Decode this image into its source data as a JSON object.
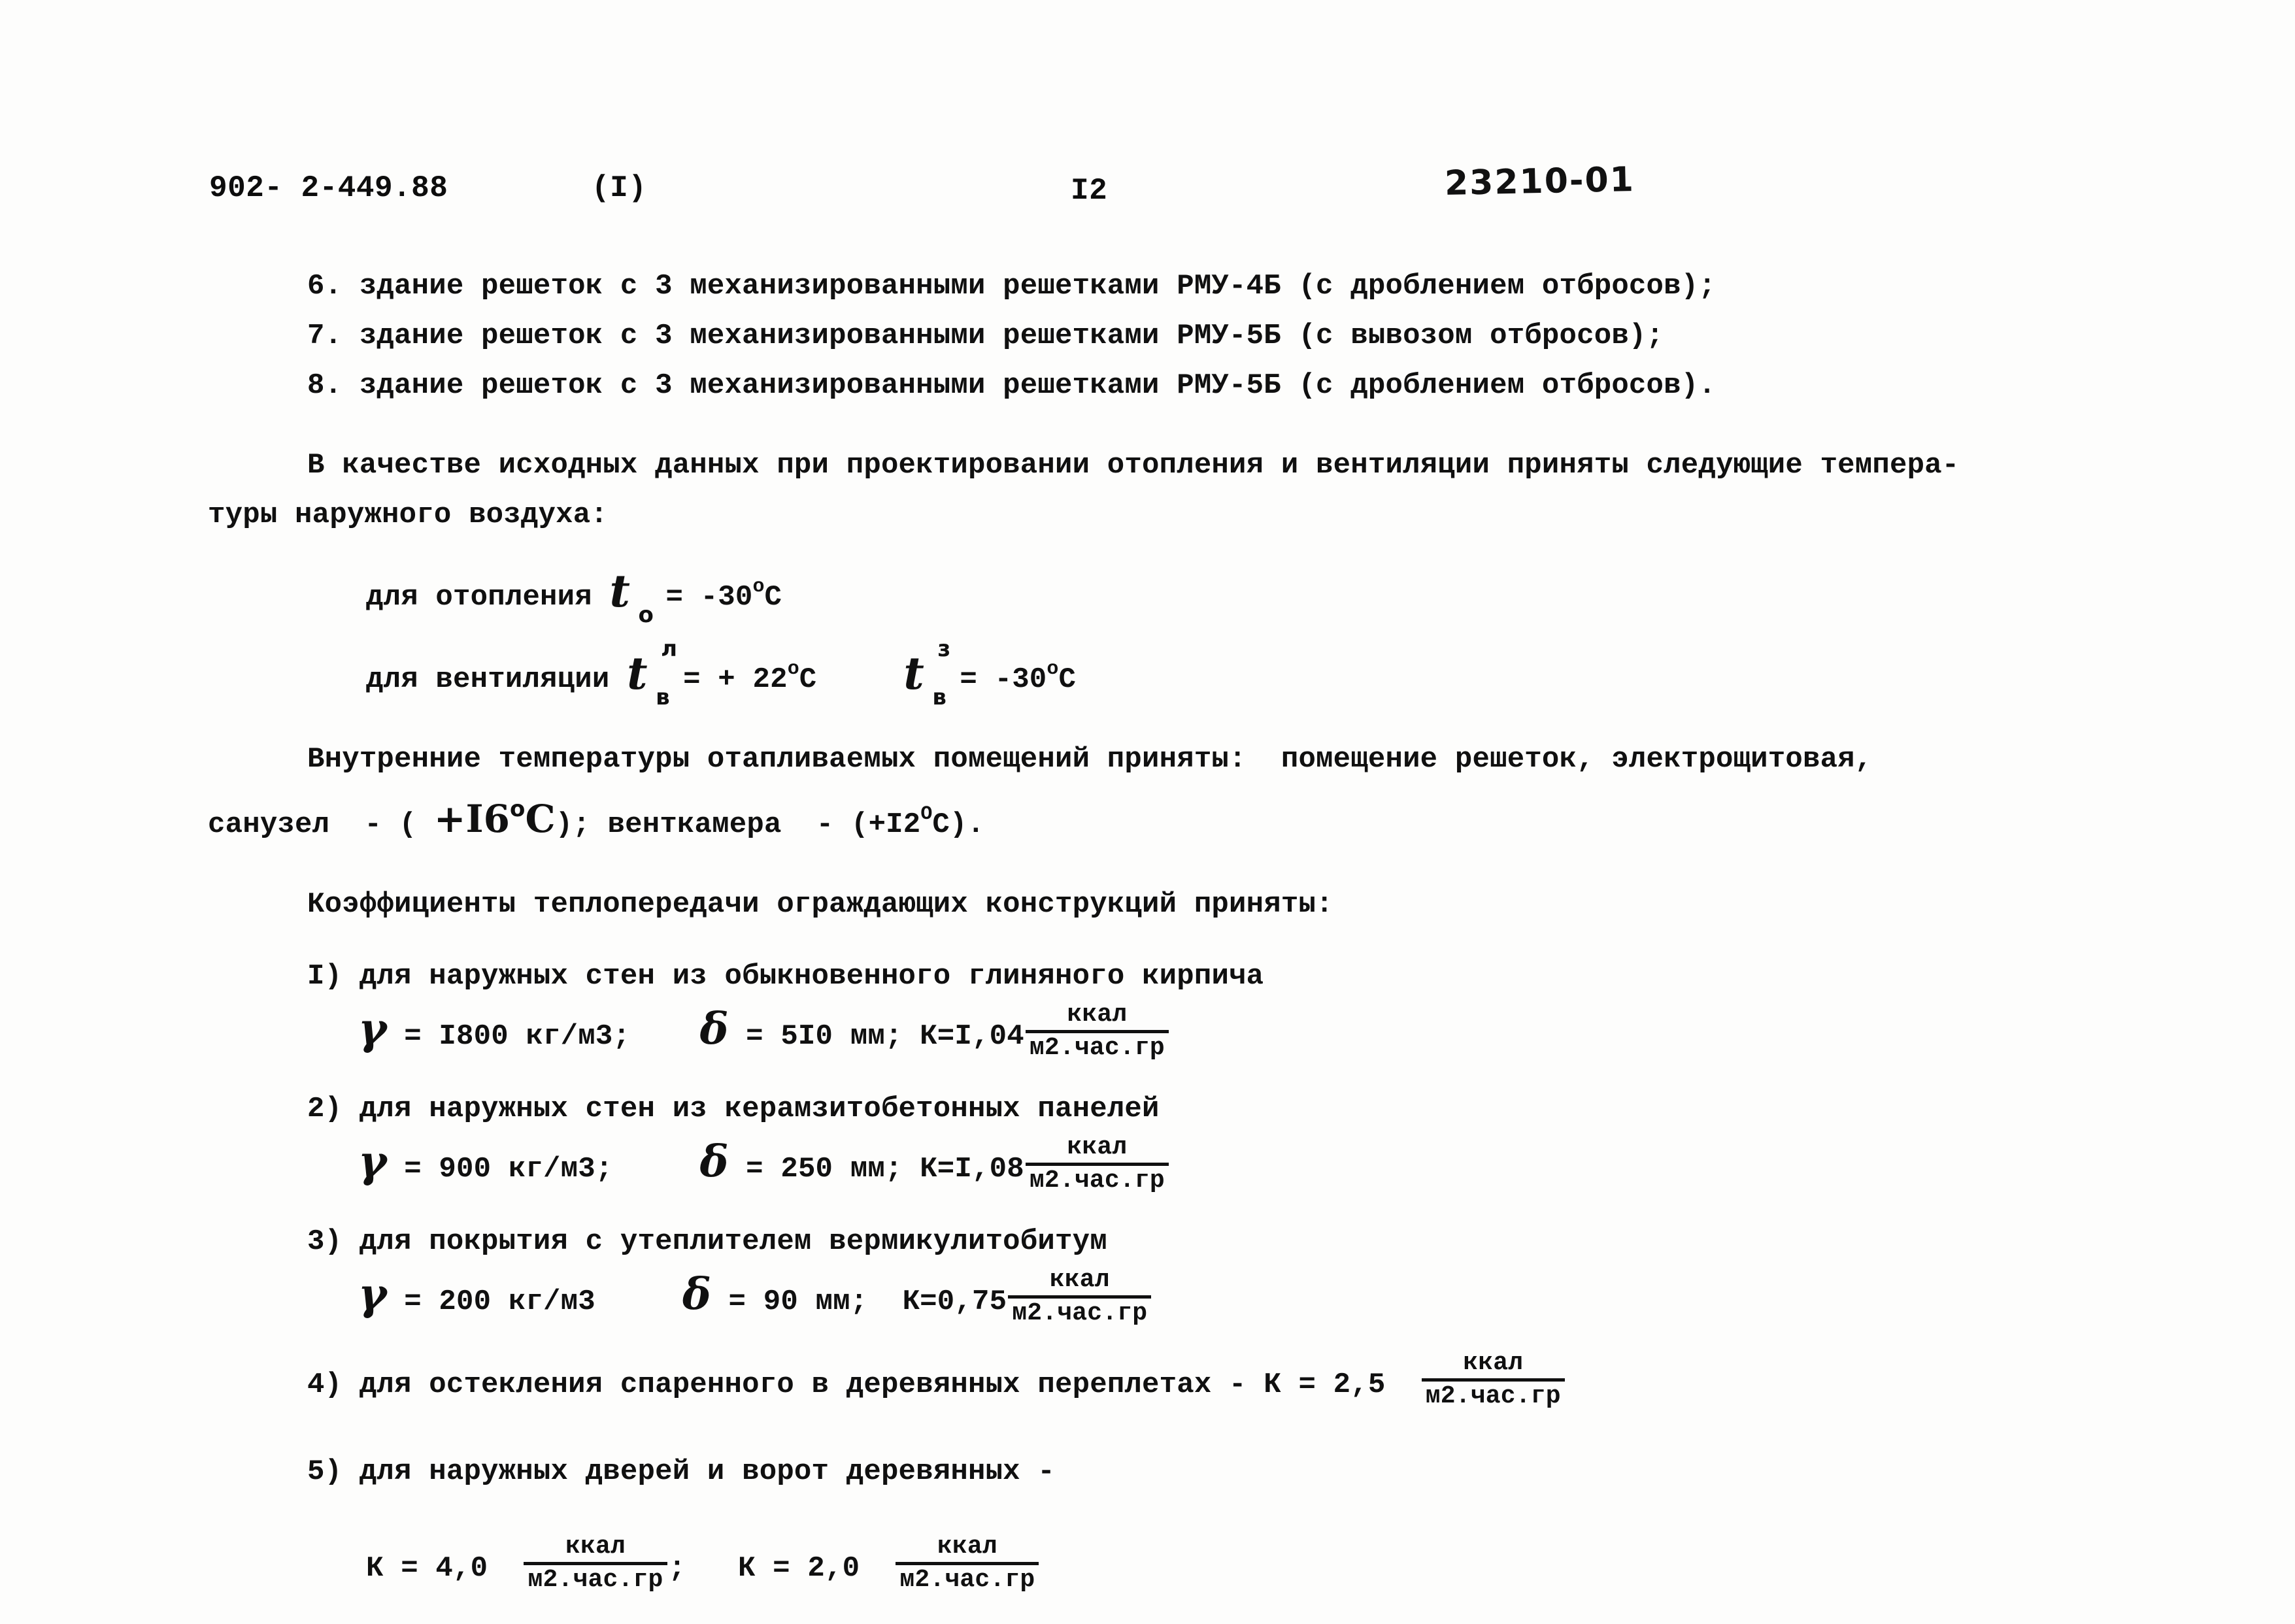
{
  "document": {
    "header": {
      "album_code": "902- 2-449.88",
      "part": "(I)",
      "page_number": "I2",
      "stamp_handwritten": "23210-01"
    },
    "list_items": [
      "6. здание решеток с 3 механизированными решетками РМУ-4Б (с дроблением отбросов);",
      "7. здание решеток с 3 механизированными решетками РМУ-5Б (с вывозом отбросов);",
      "8. здание решеток с 3 механизированными решетками РМУ-5Б (с дроблением отбросов)."
    ],
    "intro_paragraph": {
      "line1": "В качестве исходных данных при проектировании отопления и вентиляции приняты следующие темпера-",
      "line2": "туры наружного воздуха:"
    },
    "outdoor_temps": {
      "heating": {
        "label": "для отопления",
        "symbol": "t",
        "subscript": "о",
        "equals": "=",
        "value": "-30",
        "degree": "o",
        "unit": "С"
      },
      "ventilation_summer": {
        "label": "для вентиляции",
        "symbol": "t",
        "subscript": "в",
        "superscript": "л",
        "equals": "=",
        "value": "+ 22",
        "degree": "o",
        "unit": "С"
      },
      "ventilation_winter": {
        "symbol": "t",
        "subscript": "в",
        "superscript": "з",
        "equals": "=",
        "value": "-30",
        "degree": "o",
        "unit": "С"
      }
    },
    "indoor_temps": {
      "line1": "Внутренние температуры отапливаемых помещений приняты:  помещение решеток, электрощитовая,",
      "line2_start": "санузел  - ( ",
      "line2_hand": "+I6",
      "line2_hand_degree": "o",
      "line2_hand_unit": "С",
      "line2_mid": "); венткамера  - (+I2",
      "line2_degree": "O",
      "line2_end": "С)."
    },
    "coefficients_heading": "Коэффициенты теплопередачи ограждающих конструкций приняты:",
    "coefficients": [
      {
        "number": "I)",
        "description": "для наружных стен из обыкновенного глиняного кирпича",
        "gamma_symbol": "γ",
        "gamma": "= I800 кг/м3;",
        "delta_symbol": "δ",
        "delta": "= 5I0 мм;",
        "k": "К=I,04",
        "frac_num": "ккал",
        "frac_den": "м2.час.гр"
      },
      {
        "number": "2)",
        "description": "для наружных стен из керамзитобетонных панелей",
        "gamma_symbol": "γ",
        "gamma": "= 900 кг/м3;",
        "delta_symbol": "δ",
        "delta": "= 250 мм;",
        "k": "К=I,08",
        "frac_num": "ккал",
        "frac_den": "м2.час.гр"
      },
      {
        "number": "3)",
        "description": "для покрытия с утеплителем вермикулитобитум",
        "gamma_symbol": "γ",
        "gamma": "= 200 кг/м3",
        "delta_symbol": "δ",
        "delta": "= 90 мм;",
        "k": "К=0,75",
        "frac_num": "ккал",
        "frac_den": "м2.час.гр"
      },
      {
        "number": "4)",
        "description": "для остекления спаренного в деревянных переплетах - К = 2,5",
        "frac_num": "ккал",
        "frac_den": "м2.час.гр"
      },
      {
        "number": "5)",
        "description": "для наружных дверей и ворот деревянных -"
      }
    ],
    "door_values": {
      "k1_label": "К = 4,0",
      "k1_num": "ккал",
      "k1_den": "м2.час.гр",
      "separator": ";",
      "k2_label": "К = 2,0",
      "k2_num": "ккал",
      "k2_den": "м2.час.гр"
    }
  }
}
